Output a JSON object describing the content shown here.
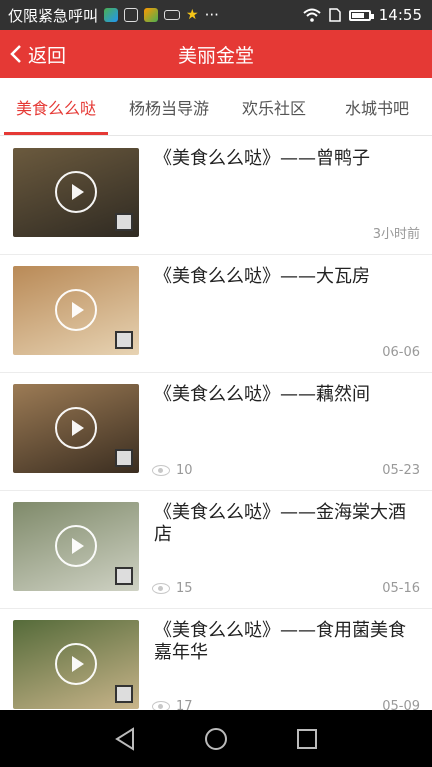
{
  "status_bar": {
    "carrier_text": "仅限紧急呼叫",
    "more": "···",
    "time": "14:55",
    "battery_level": 0.75
  },
  "header": {
    "back_label": "返回",
    "title": "美丽金堂"
  },
  "tabs": [
    {
      "label": "美食么么哒",
      "active": true
    },
    {
      "label": "杨杨当导游",
      "active": false
    },
    {
      "label": "欢乐社区",
      "active": false
    },
    {
      "label": "水城书吧",
      "active": false
    }
  ],
  "items": [
    {
      "title": "《美食么么哒》——曾鸭子",
      "views": "",
      "date": "3小时前",
      "thumb_colors": [
        "#6b5a3e",
        "#2f2a22"
      ]
    },
    {
      "title": "《美食么么哒》——大瓦房",
      "views": "",
      "date": "06-06",
      "thumb_colors": [
        "#b98a57",
        "#e7d3b3"
      ]
    },
    {
      "title": "《美食么么哒》——藕然间",
      "views": "10",
      "date": "05-23",
      "thumb_colors": [
        "#9c7b55",
        "#3a2d20"
      ]
    },
    {
      "title": "《美食么么哒》——金海棠大酒店",
      "views": "15",
      "date": "05-16",
      "thumb_colors": [
        "#7f8a6a",
        "#cfd2c4"
      ]
    },
    {
      "title": "《美食么么哒》——食用菌美食嘉年华",
      "views": "17",
      "date": "05-09",
      "thumb_colors": [
        "#556b3a",
        "#c8b48a"
      ]
    }
  ],
  "colors": {
    "accent": "#e53935",
    "statusbar": "#323232"
  },
  "icons": {
    "back": "chevron-left-icon",
    "play": "play-icon",
    "views": "eye-icon",
    "wifi": "wifi-icon",
    "battery": "battery-icon"
  }
}
